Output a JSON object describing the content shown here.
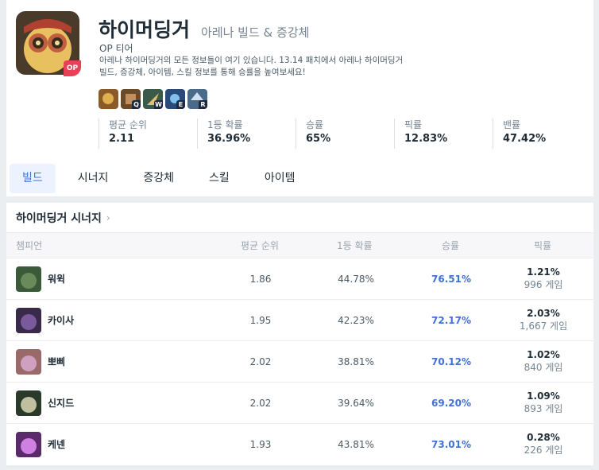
{
  "champion": {
    "name": "하이머딩거",
    "subtitle": "아레나 빌드 & 증강체",
    "tier": "OP 티어",
    "badge": "OP",
    "description": "아레나 하이머딩거의 모든 정보들이 여기 있습니다. 13.14 패치에서 아레나 하이머딩거 빌드, 증강체, 아이템, 스킬 정보를 통해 승률을 높여보세요!"
  },
  "skills": [
    {
      "key": "",
      "icon": "passive-icon",
      "color": "#8a5a2a"
    },
    {
      "key": "Q",
      "icon": "turret-icon",
      "color": "#6b4a2a"
    },
    {
      "key": "W",
      "icon": "rocket-icon",
      "color": "#3a5a4a"
    },
    {
      "key": "E",
      "icon": "grenade-icon",
      "color": "#2a4a7a"
    },
    {
      "key": "R",
      "icon": "upgrade-icon",
      "color": "#4a6a8a"
    }
  ],
  "stats": [
    {
      "label": "평균 순위",
      "value": "2.11"
    },
    {
      "label": "1등 확률",
      "value": "36.96%"
    },
    {
      "label": "승률",
      "value": "65%"
    },
    {
      "label": "픽률",
      "value": "12.83%"
    },
    {
      "label": "밴률",
      "value": "47.42%"
    }
  ],
  "tabs": [
    {
      "label": "빌드",
      "active": true
    },
    {
      "label": "시너지",
      "active": false
    },
    {
      "label": "증강체",
      "active": false
    },
    {
      "label": "스킬",
      "active": false
    },
    {
      "label": "아이템",
      "active": false
    }
  ],
  "synergy": {
    "title": "하이머딩거 시너지",
    "headers": {
      "champion": "챔피언",
      "avg_rank": "평균 순위",
      "first_rate": "1등 확률",
      "win_rate": "승률",
      "pick_rate": "픽률"
    },
    "rows": [
      {
        "name": "워윅",
        "avg_rank": "1.86",
        "first_rate": "44.78%",
        "win_rate": "76.51%",
        "pick_rate": "1.21%",
        "games": "996 게임",
        "color": "#3a5a3a"
      },
      {
        "name": "카이사",
        "avg_rank": "1.95",
        "first_rate": "42.23%",
        "win_rate": "72.17%",
        "pick_rate": "2.03%",
        "games": "1,667 게임",
        "color": "#3a2a4a"
      },
      {
        "name": "뽀삐",
        "avg_rank": "2.02",
        "first_rate": "38.81%",
        "win_rate": "70.12%",
        "pick_rate": "1.02%",
        "games": "840 게임",
        "color": "#9a6a6a"
      },
      {
        "name": "신지드",
        "avg_rank": "2.02",
        "first_rate": "39.64%",
        "win_rate": "69.20%",
        "pick_rate": "1.09%",
        "games": "893 게임",
        "color": "#2a3a2a"
      },
      {
        "name": "케넨",
        "avg_rank": "1.93",
        "first_rate": "43.81%",
        "win_rate": "73.01%",
        "pick_rate": "0.28%",
        "games": "226 게임",
        "color": "#5a2a6a"
      }
    ]
  }
}
